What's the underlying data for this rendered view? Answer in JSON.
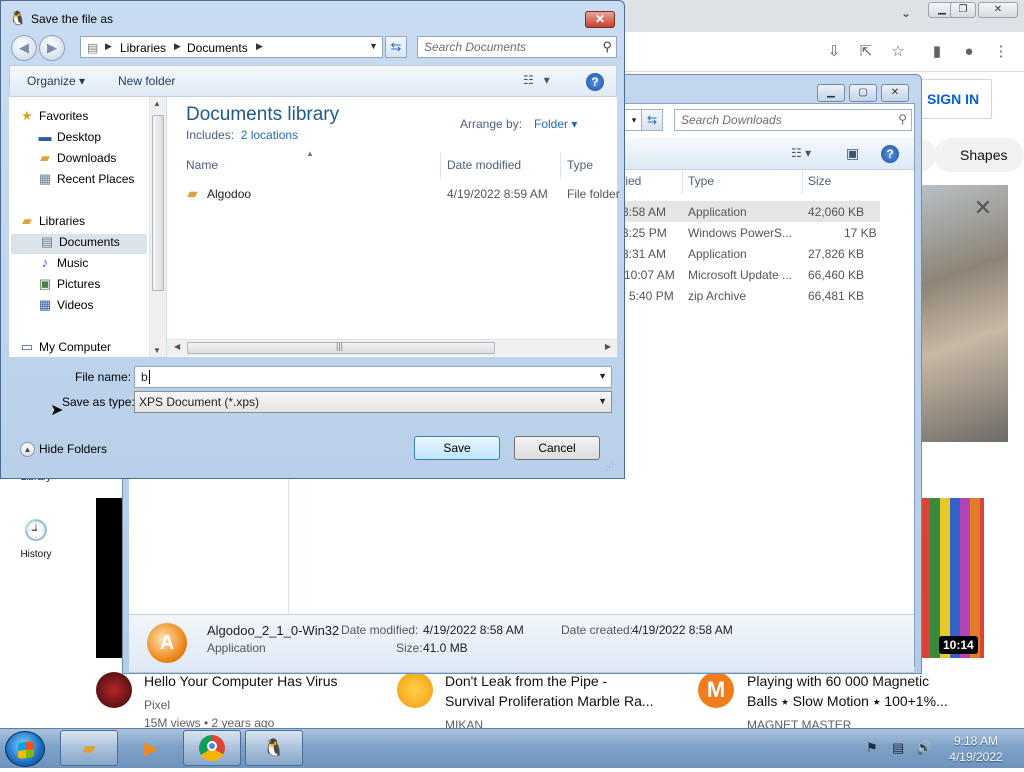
{
  "dialog": {
    "title": "Save the file as",
    "breadcrumb": [
      "Libraries",
      "Documents"
    ],
    "search_placeholder": "Search Documents",
    "organize": "Organize",
    "new_folder": "New folder",
    "library_title": "Documents library",
    "includes_label": "Includes:",
    "includes_link": "2 locations",
    "arrange_by_label": "Arrange by:",
    "arrange_by_value": "Folder",
    "columns": [
      "Name",
      "Date modified",
      "Type"
    ],
    "files": [
      {
        "name": "Algodoo",
        "date": "4/19/2022 8:59 AM",
        "type": "File folder"
      }
    ],
    "nav": {
      "favorites": "Favorites",
      "desktop": "Desktop",
      "downloads": "Downloads",
      "recent": "Recent Places",
      "libraries": "Libraries",
      "documents": "Documents",
      "music": "Music",
      "pictures": "Pictures",
      "videos": "Videos",
      "computer": "My Computer"
    },
    "file_name_label": "File name:",
    "file_name_value": "b",
    "save_type_label": "Save as type:",
    "save_type_value": "XPS Document (*.xps)",
    "hide_folders": "Hide Folders",
    "save_btn": "Save",
    "cancel_btn": "Cancel"
  },
  "explorer": {
    "search_placeholder": "Search Downloads",
    "columns": [
      "fied",
      "Type",
      "Size"
    ],
    "rows": [
      {
        "time": "3:58 AM",
        "type": "Application",
        "size": "42,060 KB"
      },
      {
        "time": "3:25 PM",
        "type": "Windows PowerS...",
        "size": "17 KB"
      },
      {
        "time": "3:31 AM",
        "type": "Application",
        "size": "27,826 KB"
      },
      {
        "time": "10:07 AM",
        "type": "Microsoft Update ...",
        "size": "66,460 KB"
      },
      {
        "time": "5:40 PM",
        "type": "zip Archive",
        "size": "66,481 KB"
      }
    ],
    "details": {
      "name": "Algodoo_2_1_0-Win32",
      "kind": "Application",
      "modified_label": "Date modified:",
      "modified_value": "4/19/2022 8:58 AM",
      "created_label": "Date created:",
      "created_value": "4/19/2022 8:58 AM",
      "size_label": "Size:",
      "size_value": "41.0 MB"
    }
  },
  "youtube": {
    "sign_in": "SIGN IN",
    "chip": "Shapes",
    "library_label": "Library",
    "history_label": "History",
    "duration": "10:14",
    "videos": [
      {
        "title": "Hello Your Computer Has Virus",
        "channel": "Pixel",
        "meta": "15M views • 2 years ago"
      },
      {
        "title": "Don't Leak from the Pipe - Survival Proliferation Marble Ra...",
        "channel": "MIKAN"
      },
      {
        "title": "Playing with 60 000 Magnetic Balls ⭑ Slow Motion ⭑ 100+1%...",
        "channel": "MAGNET MASTER"
      }
    ]
  },
  "taskbar": {
    "time": "9:18 AM",
    "date": "4/19/2022"
  }
}
